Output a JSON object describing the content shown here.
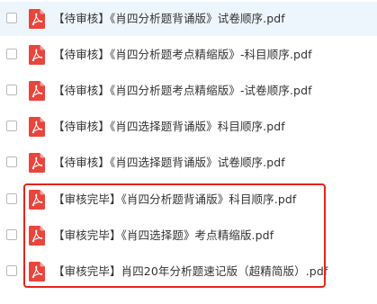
{
  "file_list": {
    "items": [
      {
        "name": "【待审核】《肖四分析题背诵版》试卷顺序.pdf",
        "icon": "pdf-icon",
        "selected": true
      },
      {
        "name": "【待审核】《肖四分析题考点精缩版》-科目顺序.pdf",
        "icon": "pdf-icon"
      },
      {
        "name": "【待审核】《肖四分析题考点精缩版》-试卷顺序.pdf",
        "icon": "pdf-icon"
      },
      {
        "name": "【待审核】《肖四选择题背诵版》科目顺序.pdf",
        "icon": "pdf-icon"
      },
      {
        "name": "【待审核】《肖四选择题背诵版》试卷顺序.pdf",
        "icon": "pdf-icon"
      },
      {
        "name": "【审核完毕】《肖四分析题背诵版》科目顺序.pdf",
        "icon": "pdf-icon"
      },
      {
        "name": "【审核完毕】《肖四选择题》考点精缩版.pdf",
        "icon": "pdf-icon"
      },
      {
        "name": "【审核完毕】肖四20年分析题速记版（超精简版）.pdf",
        "icon": "pdf-icon"
      }
    ]
  },
  "colors": {
    "pdf_icon": "#e8453c",
    "highlight_border": "#e4241a",
    "selected_row": "#eef6fd",
    "text": "#333333"
  }
}
